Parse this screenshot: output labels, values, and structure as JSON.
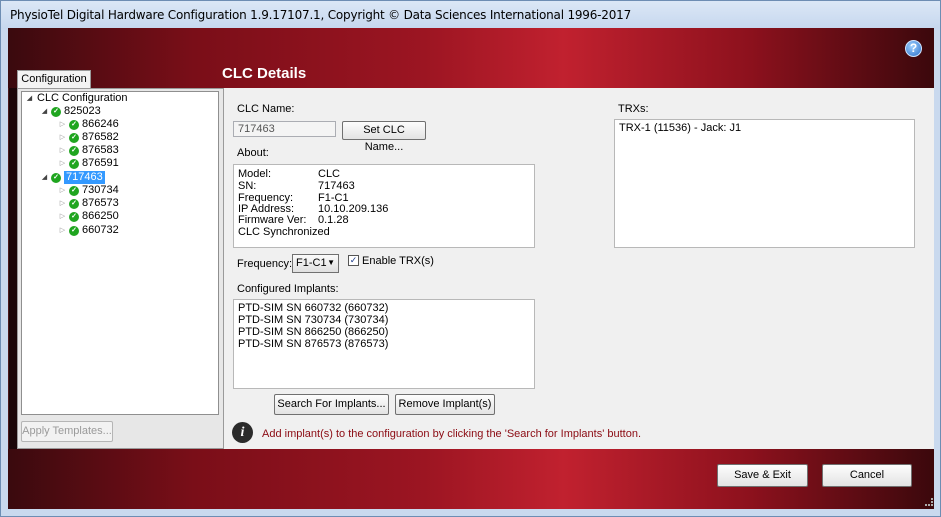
{
  "window": {
    "title": "PhysioTel Digital Hardware Configuration 1.9.17107.1, Copyright © Data Sciences International 1996-2017"
  },
  "help": {
    "glyph": "?"
  },
  "left": {
    "tab_label": "Configuration",
    "tree": {
      "root": "CLC Configuration",
      "clcs": [
        {
          "name": "825023",
          "implants": [
            "866246",
            "876582",
            "876583",
            "876591"
          ]
        },
        {
          "name": "717463",
          "implants": [
            "730734",
            "876573",
            "866250",
            "660732"
          ]
        }
      ]
    },
    "apply_templates_label": "Apply Templates..."
  },
  "details": {
    "section_title": "CLC Details",
    "clc_name_label": "CLC Name:",
    "clc_name_value": "717463",
    "set_name_button": "Set CLC Name...",
    "about_label": "About:",
    "about": [
      {
        "k": "Model:",
        "v": "CLC"
      },
      {
        "k": "SN:",
        "v": "717463"
      },
      {
        "k": "Frequency:",
        "v": "F1-C1"
      },
      {
        "k": "IP Address:",
        "v": "10.10.209.136"
      },
      {
        "k": "Firmware Ver:",
        "v": "0.1.28"
      }
    ],
    "sync_status": "CLC Synchronized",
    "frequency_label": "Frequency:",
    "frequency_value": "F1-C1",
    "enable_trx_label": "Enable TRX(s)",
    "configured_label": "Configured Implants:",
    "configured": [
      "PTD-SIM SN 660732 (660732)",
      "PTD-SIM SN 730734 (730734)",
      "PTD-SIM SN 866250 (866250)",
      "PTD-SIM SN 876573 (876573)"
    ],
    "search_button": "Search For Implants...",
    "remove_button": "Remove Implant(s)",
    "trx_label": "TRXs:",
    "trx_items": [
      "TRX-1 (11536) - Jack: J1"
    ],
    "info_text": "Add implant(s) to the configuration by clicking the 'Search for Implants' button."
  },
  "footer": {
    "save_exit": "Save & Exit",
    "cancel": "Cancel"
  }
}
